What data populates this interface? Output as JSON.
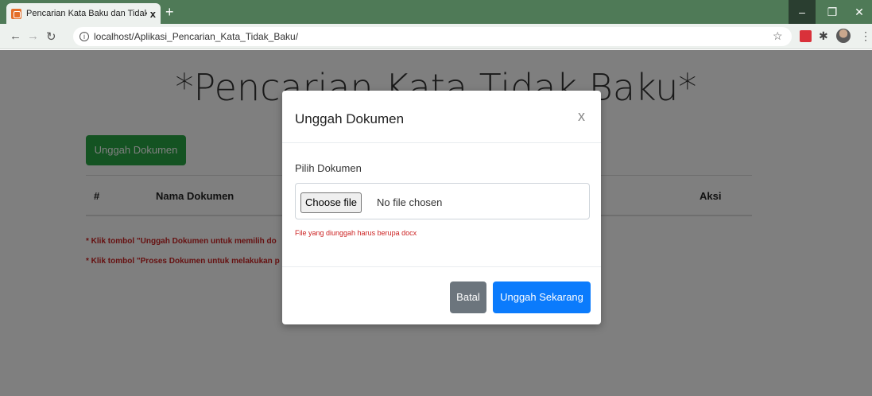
{
  "browser": {
    "tab_title": "Pencarian Kata Baku dan Tidak B",
    "tab_close": "x",
    "new_tab": "+",
    "url": "localhost/Aplikasi_Pencarian_Kata_Tidak_Baku/",
    "theme_color": "#4f7a57"
  },
  "page": {
    "heading": "*Pencarian Kata Tidak Baku*",
    "upload_button": "Unggah Dokumen",
    "table_headers": [
      "#",
      "Nama Dokumen",
      "Aksi"
    ],
    "notes": [
      "* Klik tombol \"Unggah Dokumen untuk memilih do",
      "* Klik tombol \"Proses Dokumen untuk melakukan p"
    ]
  },
  "modal": {
    "title": "Unggah Dokumen",
    "close": "x",
    "field_label": "Pilih Dokumen",
    "choose_file": "Choose file",
    "file_status": "No file chosen",
    "help_text": "File yang diunggah harus berupa docx",
    "cancel_button": "Batal",
    "submit_button": "Unggah Sekarang"
  },
  "colors": {
    "success": "#28a745",
    "primary": "#0b7bfc",
    "secondary": "#6c757d",
    "danger": "#cc2222"
  }
}
